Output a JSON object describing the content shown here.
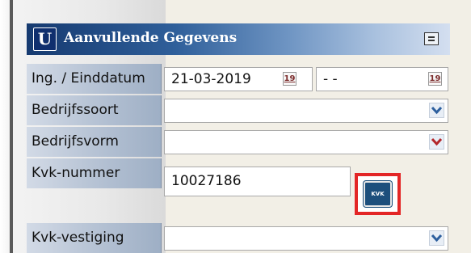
{
  "panel": {
    "logo_text": "U",
    "title": "Aanvullende Gegevens"
  },
  "rows": [
    {
      "label": "Ing. / Einddatum",
      "value_start": "21-03-2019",
      "value_end": "- -",
      "calendar_icon_text": "19"
    },
    {
      "label": "Bedrijfssoort",
      "value": ""
    },
    {
      "label": "Bedrijfsvorm",
      "value": ""
    },
    {
      "label": "Kvk-nummer",
      "value": "10027186",
      "kvk_button_text": "KVK"
    },
    {
      "label": "Kvk-vestiging",
      "value": ""
    }
  ],
  "colors": {
    "highlight": "#e32626",
    "header_dark": "#163a70",
    "dropdown_arrow_blue": "#2d5f9e",
    "dropdown_arrow_red": "#b3272b"
  },
  "icons": [
    "logo-icon",
    "menu-icon",
    "calendar-icon",
    "chevron-down-icon",
    "kvk-icon"
  ]
}
